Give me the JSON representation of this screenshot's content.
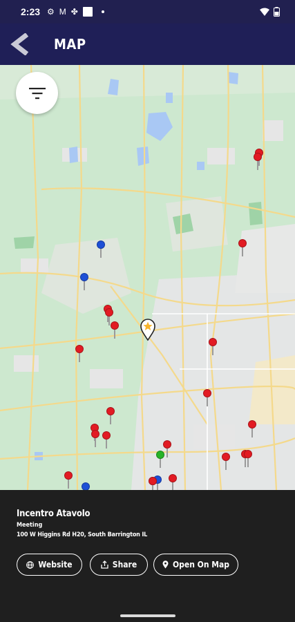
{
  "status_bar": {
    "time": "2:23"
  },
  "app_bar": {
    "title": "MAP"
  },
  "map": {
    "filter_icon": "filter-icon",
    "pins": [
      {
        "color": "red"
      },
      {
        "color": "red"
      },
      {
        "color": "red"
      },
      {
        "color": "blue"
      },
      {
        "color": "blue"
      },
      {
        "color": "red"
      },
      {
        "color": "red"
      },
      {
        "color": "red"
      },
      {
        "color": "red"
      },
      {
        "color": "red"
      },
      {
        "color": "red"
      },
      {
        "color": "red"
      },
      {
        "color": "red"
      },
      {
        "color": "red"
      },
      {
        "color": "red"
      },
      {
        "color": "red"
      },
      {
        "color": "red"
      },
      {
        "color": "red"
      },
      {
        "color": "red"
      },
      {
        "color": "red"
      },
      {
        "color": "green"
      },
      {
        "color": "red"
      },
      {
        "color": "blue"
      },
      {
        "color": "red"
      },
      {
        "color": "red"
      },
      {
        "color": "red"
      },
      {
        "color": "blue"
      }
    ]
  },
  "place": {
    "name": "Incentro Atavolo",
    "type": "Meeting",
    "address": "100 W Higgins Rd H20, South Barrington IL"
  },
  "actions": {
    "website": "Website",
    "share": "Share",
    "open_on_map": "Open On Map"
  },
  "colors": {
    "app_bar": "#1f1f57",
    "status_bar": "#212050",
    "card_bg": "#1f1f1f",
    "map_green": "#cfe9cf",
    "pin_red": "#e21b23",
    "pin_blue": "#1d4fd6",
    "pin_green": "#26b327"
  }
}
